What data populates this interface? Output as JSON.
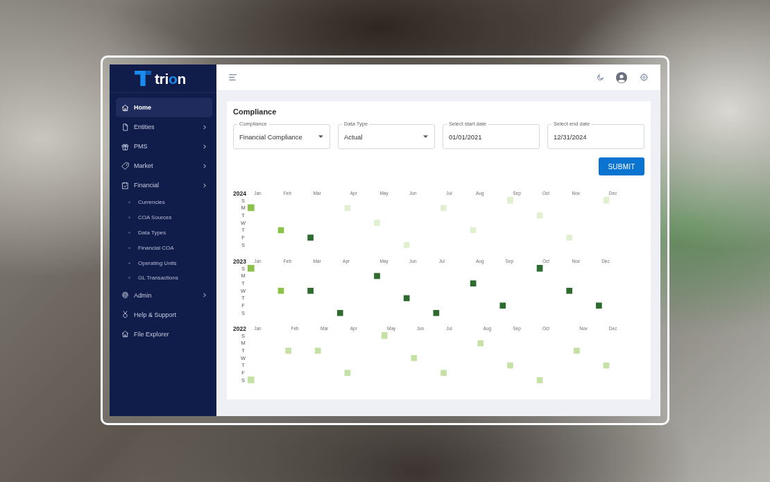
{
  "sidebar": {
    "logo": "trion",
    "items": [
      {
        "label": "Home",
        "selected": true,
        "has_submenu": false
      },
      {
        "label": "Entities",
        "selected": false,
        "has_submenu": true
      },
      {
        "label": "PMS",
        "selected": false,
        "has_submenu": true
      },
      {
        "label": "Market",
        "selected": false,
        "has_submenu": true
      },
      {
        "label": "Financial",
        "selected": false,
        "has_submenu": true,
        "children": [
          {
            "label": "Currencies",
            "selected": false
          },
          {
            "label": "COA Sources",
            "selected": false
          },
          {
            "label": "Data Types",
            "selected": false
          },
          {
            "label": "Financial COA",
            "selected": false
          },
          {
            "label": "Operating Units",
            "selected": false
          },
          {
            "label": "GL Transactions",
            "selected": false
          }
        ]
      },
      {
        "label": "Admin",
        "selected": false,
        "has_submenu": true
      },
      {
        "label": "Help & Support",
        "selected": false,
        "has_submenu": false
      },
      {
        "label": "File Explorer",
        "selected": false,
        "has_submenu": false
      }
    ]
  },
  "filters": {
    "title": "Compliance",
    "fields": [
      {
        "kind": "select",
        "label": "Compliance",
        "value": "Financial Compliance"
      },
      {
        "kind": "select",
        "label": "Data Type",
        "value": "Actual"
      },
      {
        "kind": "date",
        "label": "Select start date",
        "value": "01/01/2021"
      },
      {
        "kind": "date",
        "label": "Select end date",
        "value": "12/31/2024"
      }
    ],
    "submit": "SUBMIT"
  },
  "compliance_calendar": {
    "years": [
      {
        "year": "2024",
        "weekdays": [
          "S",
          "M",
          "T",
          "W",
          "T",
          "F",
          "S"
        ],
        "months": [
          {
            "label": "Jan",
            "color": "#8bc34a"
          },
          {
            "label": "Feb",
            "color": "#8bc34a"
          },
          {
            "label": "Mar",
            "color": "#2e6b2f"
          },
          {
            "label": "Apr",
            "color": "#e2f0d2"
          },
          {
            "label": "May",
            "color": "#e2f0d2"
          },
          {
            "label": "Jun",
            "color": "#e2f0d2"
          },
          {
            "label": "Jul",
            "color": "#e2f0d2"
          },
          {
            "label": "Aug",
            "color": "#e2f0d2"
          },
          {
            "label": "Sep",
            "color": "#e2f0d2"
          },
          {
            "label": "Oct",
            "color": "#e2f0d2"
          },
          {
            "label": "Nov",
            "color": "#e2f0d2"
          },
          {
            "label": "Dec",
            "color": "#e2f0d2"
          }
        ]
      },
      {
        "year": "2023",
        "weekdays": [
          "S",
          "M",
          "T",
          "W",
          "T",
          "F",
          "S"
        ],
        "months": [
          {
            "label": "Jan",
            "color": "#8bc34a"
          },
          {
            "label": "Feb",
            "color": "#8bc34a"
          },
          {
            "label": "Mar",
            "color": "#2e6b2f"
          },
          {
            "label": "Apr",
            "color": "#2e6b2f"
          },
          {
            "label": "May",
            "color": "#2e6b2f"
          },
          {
            "label": "Jun",
            "color": "#2e6b2f"
          },
          {
            "label": "Jul",
            "color": "#2e6b2f"
          },
          {
            "label": "Aug",
            "color": "#2e6b2f"
          },
          {
            "label": "Sep",
            "color": "#2e6b2f"
          },
          {
            "label": "Oct",
            "color": "#2e6b2f"
          },
          {
            "label": "Nov",
            "color": "#2e6b2f"
          },
          {
            "label": "Dec",
            "color": "#2e6b2f"
          }
        ]
      },
      {
        "year": "2022",
        "weekdays": [
          "S",
          "M",
          "T",
          "W",
          "T",
          "F",
          "S"
        ],
        "months": [
          {
            "label": "Jan",
            "color": "#c5e1a5"
          },
          {
            "label": "Feb",
            "color": "#c5e1a5"
          },
          {
            "label": "Mar",
            "color": "#c5e1a5"
          },
          {
            "label": "Apr",
            "color": "#c5e1a5"
          },
          {
            "label": "May",
            "color": "#c5e1a5"
          },
          {
            "label": "Jun",
            "color": "#c5e1a5"
          },
          {
            "label": "Jul",
            "color": "#c5e1a5"
          },
          {
            "label": "Aug",
            "color": "#c5e1a5"
          },
          {
            "label": "Sep",
            "color": "#c5e1a5"
          },
          {
            "label": "Oct",
            "color": "#c5e1a5"
          },
          {
            "label": "Nov",
            "color": "#c5e1a5"
          },
          {
            "label": "Dec",
            "color": "#c5e1a5"
          }
        ]
      }
    ]
  }
}
